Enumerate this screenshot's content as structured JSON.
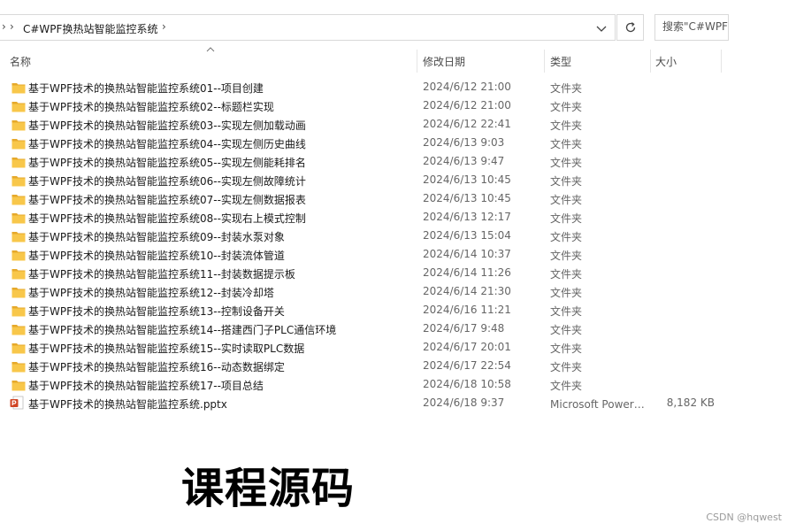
{
  "address_bar": {
    "path": "C#WPF换热站智能监控系统",
    "search_placeholder": "搜索\"C#WPF换"
  },
  "columns": {
    "name": "名称",
    "date": "修改日期",
    "type": "类型",
    "size": "大小"
  },
  "files": [
    {
      "name": "基于WPF技术的换热站智能监控系统01--项目创建",
      "date": "2024/6/12 21:00",
      "type": "文件夹",
      "size": "",
      "icon": "folder-icon"
    },
    {
      "name": "基于WPF技术的换热站智能监控系统02--标题栏实现",
      "date": "2024/6/12 21:00",
      "type": "文件夹",
      "size": "",
      "icon": "folder-icon"
    },
    {
      "name": "基于WPF技术的换热站智能监控系统03--实现左侧加载动画",
      "date": "2024/6/12 22:41",
      "type": "文件夹",
      "size": "",
      "icon": "folder-icon"
    },
    {
      "name": "基于WPF技术的换热站智能监控系统04--实现左侧历史曲线",
      "date": "2024/6/13 9:03",
      "type": "文件夹",
      "size": "",
      "icon": "folder-icon"
    },
    {
      "name": "基于WPF技术的换热站智能监控系统05--实现左侧能耗排名",
      "date": "2024/6/13 9:47",
      "type": "文件夹",
      "size": "",
      "icon": "folder-icon"
    },
    {
      "name": "基于WPF技术的换热站智能监控系统06--实现左侧故障统计",
      "date": "2024/6/13 10:45",
      "type": "文件夹",
      "size": "",
      "icon": "folder-icon"
    },
    {
      "name": "基于WPF技术的换热站智能监控系统07--实现左侧数据报表",
      "date": "2024/6/13 10:45",
      "type": "文件夹",
      "size": "",
      "icon": "folder-icon"
    },
    {
      "name": "基于WPF技术的换热站智能监控系统08--实现右上模式控制",
      "date": "2024/6/13 12:17",
      "type": "文件夹",
      "size": "",
      "icon": "folder-icon"
    },
    {
      "name": "基于WPF技术的换热站智能监控系统09--封装水泵对象",
      "date": "2024/6/13 15:04",
      "type": "文件夹",
      "size": "",
      "icon": "folder-icon"
    },
    {
      "name": "基于WPF技术的换热站智能监控系统10--封装流体管道",
      "date": "2024/6/14 10:37",
      "type": "文件夹",
      "size": "",
      "icon": "folder-icon"
    },
    {
      "name": "基于WPF技术的换热站智能监控系统11--封装数据提示板",
      "date": "2024/6/14 11:26",
      "type": "文件夹",
      "size": "",
      "icon": "folder-icon"
    },
    {
      "name": "基于WPF技术的换热站智能监控系统12--封装冷却塔",
      "date": "2024/6/14 21:30",
      "type": "文件夹",
      "size": "",
      "icon": "folder-icon"
    },
    {
      "name": "基于WPF技术的换热站智能监控系统13--控制设备开关",
      "date": "2024/6/16 11:21",
      "type": "文件夹",
      "size": "",
      "icon": "folder-icon"
    },
    {
      "name": "基于WPF技术的换热站智能监控系统14--搭建西门子PLC通信环境",
      "date": "2024/6/17 9:48",
      "type": "文件夹",
      "size": "",
      "icon": "folder-icon"
    },
    {
      "name": "基于WPF技术的换热站智能监控系统15--实时读取PLC数据",
      "date": "2024/6/17 20:01",
      "type": "文件夹",
      "size": "",
      "icon": "folder-icon"
    },
    {
      "name": "基于WPF技术的换热站智能监控系统16--动态数据绑定",
      "date": "2024/6/17 22:54",
      "type": "文件夹",
      "size": "",
      "icon": "folder-icon"
    },
    {
      "name": "基于WPF技术的换热站智能监控系统17--项目总结",
      "date": "2024/6/18 10:58",
      "type": "文件夹",
      "size": "",
      "icon": "folder-icon"
    },
    {
      "name": "基于WPF技术的换热站智能监控系统.pptx",
      "date": "2024/6/18 9:37",
      "type": "Microsoft PowerPoint 演示文稿",
      "size": "8,182 KB",
      "icon": "pptx-icon"
    }
  ],
  "caption": "课程源码",
  "watermark": "CSDN @hqwest",
  "colors": {
    "folder": "#f8c74a",
    "folder_dark": "#e6a92b",
    "pptx": "#d04423"
  }
}
